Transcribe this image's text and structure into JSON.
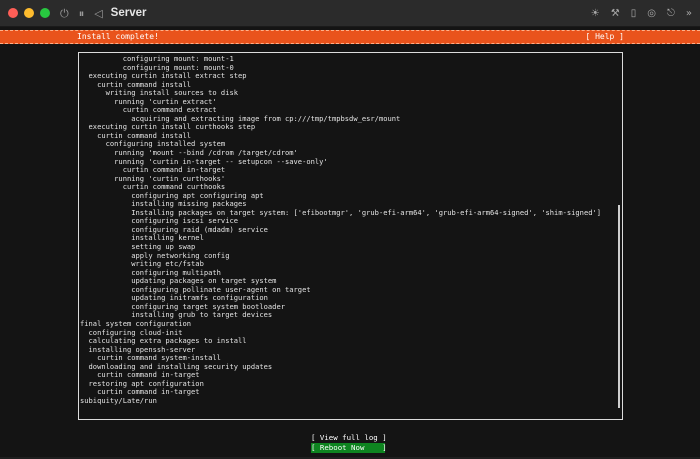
{
  "window": {
    "title": "Server",
    "traffic_colors": [
      "#ff5f57",
      "#febc2e",
      "#28c840"
    ],
    "left_icons": [
      "power-icon",
      "pause-icon",
      "back-icon"
    ],
    "right_icons": [
      "brightness-icon",
      "tools-icon",
      "usb-icon",
      "display-icon",
      "share-icon",
      "more-icon"
    ]
  },
  "installer": {
    "header_title": "Install complete!",
    "help_label": "[ Help ]",
    "accent": "#e9531c",
    "log_lines": [
      "          configuring mount: mount-1",
      "          configuring mount: mount-0",
      "  executing curtin install extract step",
      "    curtin command install",
      "      writing install sources to disk",
      "        running 'curtin extract'",
      "          curtin command extract",
      "            acquiring and extracting image from cp:///tmp/tmpbsdw_esr/mount",
      "  executing curtin install curthooks step",
      "    curtin command install",
      "      configuring installed system",
      "        running 'mount --bind /cdrom /target/cdrom'",
      "        running 'curtin in-target -- setupcon --save-only'",
      "          curtin command in-target",
      "        running 'curtin curthooks'",
      "          curtin command curthooks",
      "            configuring apt configuring apt",
      "            installing missing packages",
      "            Installing packages on target system: ['efibootmgr', 'grub-efi-arm64', 'grub-efi-arm64-signed', 'shim-signed']",
      "            configuring iscsi service",
      "            configuring raid (mdadm) service",
      "            installing kernel",
      "            setting up swap",
      "            apply networking config",
      "            writing etc/fstab",
      "            configuring multipath",
      "            updating packages on target system",
      "            configuring pollinate user-agent on target",
      "            updating initramfs configuration",
      "            configuring target system bootloader",
      "            installing grub to target devices",
      "final system configuration",
      "  configuring cloud-init",
      "  calculating extra packages to install",
      "  installing openssh-server",
      "    curtin command system-install",
      "  downloading and installing security updates",
      "    curtin command in-target",
      "  restoring apt configuration",
      "    curtin command in-target",
      "subiquity/Late/run"
    ]
  },
  "buttons": {
    "view_full_log": "[ View full log ]",
    "reboot_now": "[ Reboot Now    ]",
    "reboot_color": "#0e8420"
  }
}
